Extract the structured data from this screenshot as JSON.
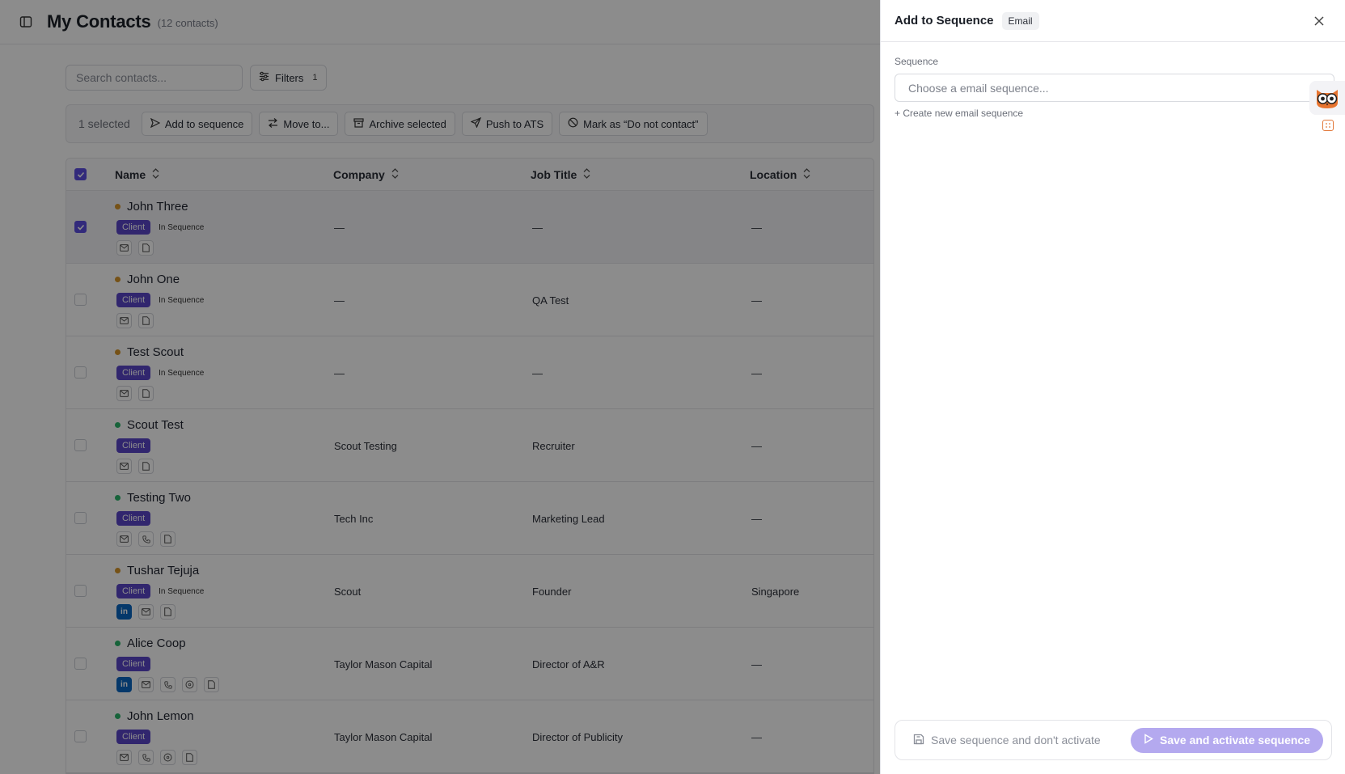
{
  "header": {
    "title": "My Contacts",
    "count": "(12 contacts)"
  },
  "toolbar": {
    "search_placeholder": "Search contacts...",
    "filters_label": "Filters",
    "filters_count": "1"
  },
  "bulk": {
    "selected": "1 selected",
    "actions": [
      "Add to sequence",
      "Move to...",
      "Archive selected",
      "Push to ATS",
      "Mark as “Do not contact”"
    ]
  },
  "table": {
    "columns": [
      "Name",
      "Company",
      "Job Title",
      "Location"
    ],
    "rows": [
      {
        "name": "John Three",
        "status_color": "#d8962a",
        "tag": "Client",
        "sequence": "In Sequence",
        "icons": [
          "mail-icon",
          "document-icon"
        ],
        "company": "—",
        "job_title": "—",
        "location": "—",
        "checked": true
      },
      {
        "name": "John One",
        "status_color": "#d8962a",
        "tag": "Client",
        "sequence": "In Sequence",
        "icons": [
          "mail-icon",
          "document-icon"
        ],
        "company": "—",
        "job_title": "QA Test",
        "location": "—",
        "checked": false
      },
      {
        "name": "Test Scout",
        "status_color": "#d8962a",
        "tag": "Client",
        "sequence": "In Sequence",
        "icons": [
          "mail-icon",
          "document-icon"
        ],
        "company": "—",
        "job_title": "—",
        "location": "—",
        "checked": false
      },
      {
        "name": "Scout Test",
        "status_color": "#2bb46a",
        "tag": "Client",
        "sequence": "",
        "icons": [
          "mail-icon",
          "document-icon"
        ],
        "company": "Scout Testing",
        "job_title": "Recruiter",
        "location": "—",
        "checked": false
      },
      {
        "name": "Testing Two",
        "status_color": "#2bb46a",
        "tag": "Client",
        "sequence": "",
        "icons": [
          "mail-icon",
          "phone-icon",
          "document-icon"
        ],
        "company": "Tech Inc",
        "job_title": "Marketing Lead",
        "location": "—",
        "checked": false
      },
      {
        "name": "Tushar Tejuja",
        "status_color": "#d8962a",
        "tag": "Client",
        "sequence": "In Sequence",
        "icons": [
          "linkedin-icon",
          "mail-icon",
          "document-icon"
        ],
        "company": "Scout",
        "job_title": "Founder",
        "location": "Singapore",
        "checked": false
      },
      {
        "name": "Alice Coop",
        "status_color": "#2bb46a",
        "tag": "Client",
        "sequence": "",
        "icons": [
          "linkedin-icon",
          "mail-icon",
          "phone-icon",
          "whatsapp-icon",
          "document-icon"
        ],
        "company": "Taylor Mason Capital",
        "job_title": "Director of A&R",
        "location": "—",
        "checked": false
      },
      {
        "name": "John Lemon",
        "status_color": "#2bb46a",
        "tag": "Client",
        "sequence": "",
        "icons": [
          "mail-icon",
          "phone-icon",
          "whatsapp-icon",
          "document-icon"
        ],
        "company": "Taylor Mason Capital",
        "job_title": "Director of Publicity",
        "location": "—",
        "checked": false
      }
    ]
  },
  "drawer": {
    "title": "Add to Sequence",
    "badge": "Email",
    "field_label": "Sequence",
    "select_placeholder": "Choose a email sequence...",
    "create_link": "+ Create new email sequence",
    "save_no_activate": "Save sequence and don't activate",
    "save_activate": "Save and activate sequence"
  },
  "colors": {
    "accent": "#5a46c9",
    "activate_button": "#b4a9ef",
    "status_in_sequence": "#d8962a",
    "status_active": "#2bb46a"
  }
}
